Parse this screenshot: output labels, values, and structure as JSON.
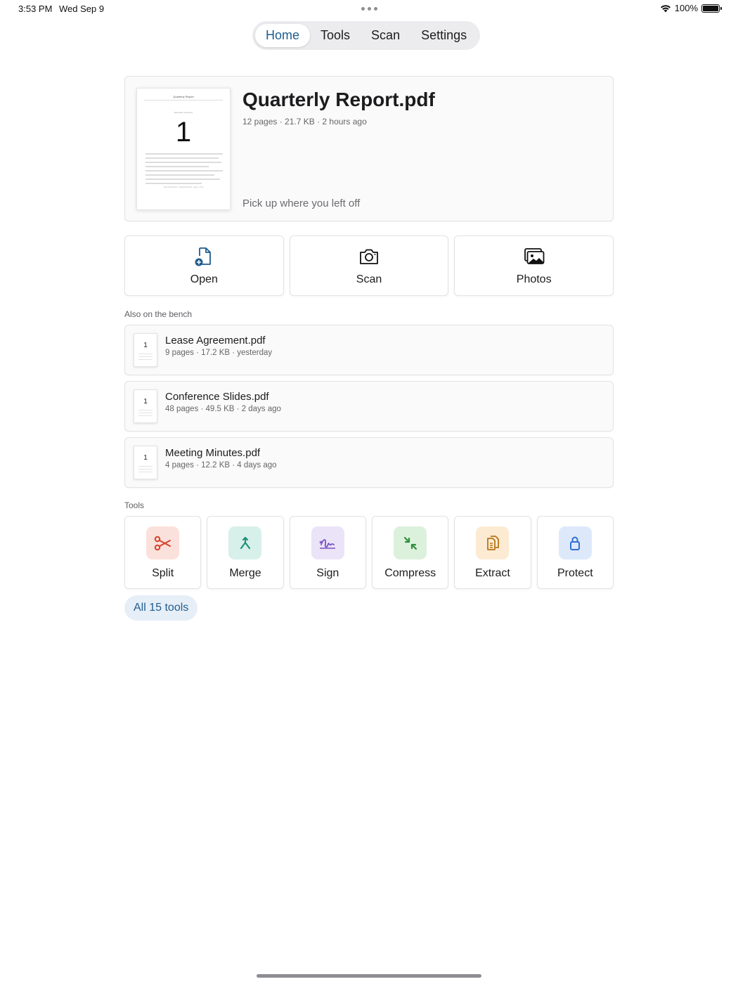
{
  "status_bar": {
    "time": "3:53 PM",
    "date": "Wed Sep 9",
    "battery": "100%",
    "battery_level": 1.0
  },
  "tabs": [
    {
      "label": "Home",
      "active": true
    },
    {
      "label": "Tools",
      "active": false
    },
    {
      "label": "Scan",
      "active": false
    },
    {
      "label": "Settings",
      "active": false
    }
  ],
  "hero": {
    "title": "Quarterly Report.pdf",
    "meta": "12 pages · 21.7 KB · 2 hours ago",
    "resume_text": "Pick up where you left off",
    "thumbnail": {
      "doc_title": "Quarterly Report",
      "subtitle": "Executive summary",
      "page_number": "1",
      "footer": "Internal document · Quarterly Report · page 1 of 12"
    }
  },
  "actions": [
    {
      "label": "Open",
      "icon": "document-plus-icon"
    },
    {
      "label": "Scan",
      "icon": "camera-icon"
    },
    {
      "label": "Photos",
      "icon": "photos-icon"
    }
  ],
  "recent": {
    "heading": "Also on the bench",
    "items": [
      {
        "name": "Lease Agreement.pdf",
        "meta": "9 pages · 17.2 KB · yesterday",
        "page": "1"
      },
      {
        "name": "Conference Slides.pdf",
        "meta": "48 pages · 49.5 KB · 2 days ago",
        "page": "1"
      },
      {
        "name": "Meeting Minutes.pdf",
        "meta": "4 pages · 12.2 KB · 4 days ago",
        "page": "1"
      }
    ]
  },
  "tools": {
    "heading": "Tools",
    "items": [
      {
        "label": "Split",
        "icon": "scissors-icon",
        "bg": "#fbe1dc",
        "fg": "#d4442e"
      },
      {
        "label": "Merge",
        "icon": "merge-icon",
        "bg": "#d7f0ea",
        "fg": "#1f8f78"
      },
      {
        "label": "Sign",
        "icon": "signature-icon",
        "bg": "#ebe3f7",
        "fg": "#7a52c4"
      },
      {
        "label": "Compress",
        "icon": "compress-icon",
        "bg": "#dcf1dc",
        "fg": "#2f8f3a"
      },
      {
        "label": "Extract",
        "icon": "extract-icon",
        "bg": "#fcebd2",
        "fg": "#b8741a"
      },
      {
        "label": "Protect",
        "icon": "lock-icon",
        "bg": "#dde9fb",
        "fg": "#2f6fd1"
      }
    ],
    "all_label": "All 15 tools"
  },
  "colors": {
    "accent": "#1f5c8f",
    "accent_bg": "#e6eef7"
  }
}
